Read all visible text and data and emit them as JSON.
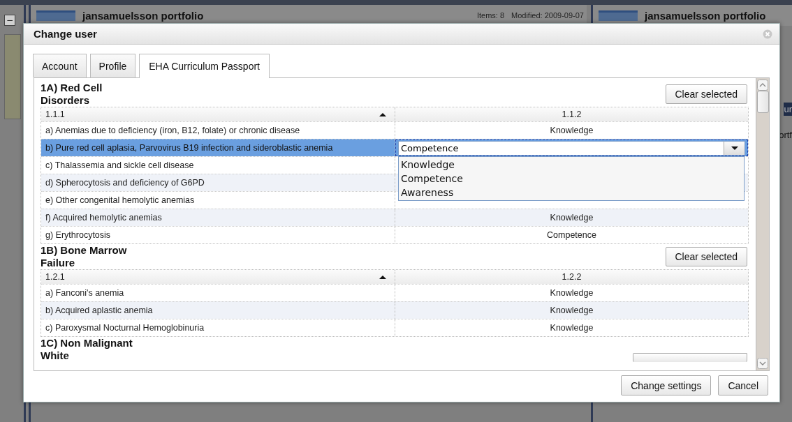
{
  "background": {
    "left_panel": {
      "collapse_button": "−"
    },
    "panels": [
      {
        "title": "jansamuelsson portfolio",
        "meta": [
          "Items: 8",
          "Modified: 2009-09-07"
        ]
      },
      {
        "title": "jansamuelsson portfolio",
        "fragments": [
          "ur",
          "ortf"
        ]
      }
    ]
  },
  "dialog": {
    "title": "Change user",
    "tabs": [
      {
        "label": "Account",
        "selected": false
      },
      {
        "label": "Profile",
        "selected": false
      },
      {
        "label": "EHA Curriculum Passport",
        "selected": true
      }
    ],
    "sections": [
      {
        "title": "1A) Red Cell Disorders",
        "button": "Clear selected",
        "columns": [
          "1.1.1",
          "1.1.2"
        ],
        "rows": [
          {
            "label": "a) Anemias due to deficiency (iron, B12, folate) or chronic disease",
            "value": "Knowledge",
            "selected": false
          },
          {
            "label": "b) Pure red cell aplasia, Parvovirus B19 infection and sideroblastic anemia",
            "selected": true,
            "editor": {
              "value": "Competence",
              "options": [
                "Knowledge",
                "Competence",
                "Awareness"
              ]
            }
          },
          {
            "label": "c) Thalassemia and sickle cell disease",
            "selected": false
          },
          {
            "label": "d) Spherocytosis and deficiency of G6PD",
            "selected": false
          },
          {
            "label": "e) Other congenital hemolytic anemias",
            "selected": false
          },
          {
            "label": "f) Acquired hemolytic anemias",
            "value": "Knowledge",
            "selected": false
          },
          {
            "label": "g) Erythrocytosis",
            "value": "Competence",
            "selected": false
          }
        ]
      },
      {
        "title": "1B) Bone Marrow Failure",
        "button": "Clear selected",
        "columns": [
          "1.2.1",
          "1.2.2"
        ],
        "rows": [
          {
            "label": "a) Fanconi's anemia",
            "value": "Knowledge",
            "selected": false
          },
          {
            "label": "b) Acquired aplastic anemia",
            "value": "Knowledge",
            "selected": false
          },
          {
            "label": "c) Paroxysmal Nocturnal Hemoglobinuria",
            "value": "Knowledge",
            "selected": false
          }
        ]
      },
      {
        "title": "1C) Non Malignant White"
      }
    ],
    "buttons": [
      "Change settings",
      "Cancel"
    ]
  }
}
